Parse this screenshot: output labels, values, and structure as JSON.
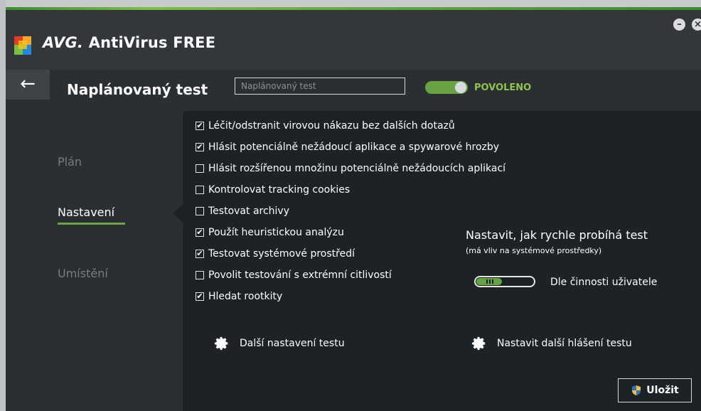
{
  "app": {
    "brand": "AVG.",
    "product": "AntiVirus FREE",
    "minimize_glyph": "–",
    "close_glyph": "×"
  },
  "header": {
    "back_glyph": "←",
    "title": "Naplánovaný test",
    "name_input": {
      "value": "",
      "placeholder": "Naplánovaný test"
    },
    "toggle": {
      "state": "on",
      "label": "POVOLENO"
    }
  },
  "sidebar": {
    "items": [
      {
        "label": "Plán",
        "active": false
      },
      {
        "label": "Nastavení",
        "active": true
      },
      {
        "label": "Umístění",
        "active": false
      }
    ]
  },
  "options": [
    {
      "label": "Léčit/odstranit virovou nákazu bez dalších dotazů",
      "checked": true
    },
    {
      "label": "Hlásit potenciálně nežádoucí aplikace a spywarové hrozby",
      "checked": true
    },
    {
      "label": "Hlásit rozšířenou množinu potenciálně nežádoucích aplikací",
      "checked": false
    },
    {
      "label": "Kontrolovat tracking cookies",
      "checked": false
    },
    {
      "label": "Testovat archivy",
      "checked": false
    },
    {
      "label": "Použít heuristickou analýzu",
      "checked": true
    },
    {
      "label": "Testovat systémové prostředí",
      "checked": true
    },
    {
      "label": "Povolit testování s extrémní citlivostí",
      "checked": false
    },
    {
      "label": "Hledat rootkity",
      "checked": true
    }
  ],
  "speed": {
    "title": "Nastavit, jak rychle probíhá test",
    "subtitle": "(má vliv na systémové prostředky)",
    "level": 0.45,
    "value_label": "Dle činnosti uživatele"
  },
  "actions": {
    "more_settings": "Další nastavení testu",
    "more_reports": "Nastavit další hlášení testu",
    "save": "Uložit"
  },
  "colors": {
    "accent_green": "#6aa341",
    "panel_bg": "#1d2226",
    "window_bg": "#2b2f33"
  },
  "icons": {
    "back": "arrow-left-icon",
    "settings": "gear-icon",
    "save": "uac-shield-icon",
    "check": "✔"
  }
}
